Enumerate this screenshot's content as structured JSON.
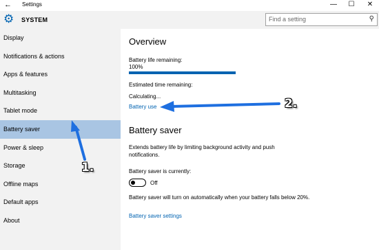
{
  "window": {
    "title": "Settings",
    "back_icon": "back-arrow-icon",
    "controls": {
      "minimize": "—",
      "maximize": "☐",
      "close": "✕"
    }
  },
  "sidebar": {
    "header_icon": "gear-icon",
    "header": "SYSTEM",
    "items": [
      {
        "label": "Display",
        "selected": false
      },
      {
        "label": "Notifications & actions",
        "selected": false
      },
      {
        "label": "Apps & features",
        "selected": false
      },
      {
        "label": "Multitasking",
        "selected": false
      },
      {
        "label": "Tablet mode",
        "selected": false
      },
      {
        "label": "Battery saver",
        "selected": true
      },
      {
        "label": "Power & sleep",
        "selected": false
      },
      {
        "label": "Storage",
        "selected": false
      },
      {
        "label": "Offline maps",
        "selected": false
      },
      {
        "label": "Default apps",
        "selected": false
      },
      {
        "label": "About",
        "selected": false
      }
    ]
  },
  "search": {
    "placeholder": "Find a setting",
    "icon": "search-icon"
  },
  "overview": {
    "title": "Overview",
    "battery_life_label": "Battery life remaining:",
    "battery_life_value": "100%",
    "battery_level": 1.0,
    "estimated_label": "Estimated time remaining:",
    "estimated_value": "Calculating...",
    "battery_use_link": "Battery use"
  },
  "battery_saver": {
    "title": "Battery saver",
    "description": "Extends battery life by limiting background activity and push notifications.",
    "status_label": "Battery saver is currently:",
    "toggle_state": "Off",
    "auto_text": "Battery saver will turn on automatically when your battery falls below 20%.",
    "settings_link": "Battery saver settings"
  },
  "annotations": {
    "label_1": "1.",
    "label_2": "2.",
    "arrow_color": "#1e6fe0"
  },
  "colors": {
    "accent": "#0063b1",
    "selected_bg": "#a9c5e3",
    "sidebar_bg": "#f2f2f2"
  }
}
